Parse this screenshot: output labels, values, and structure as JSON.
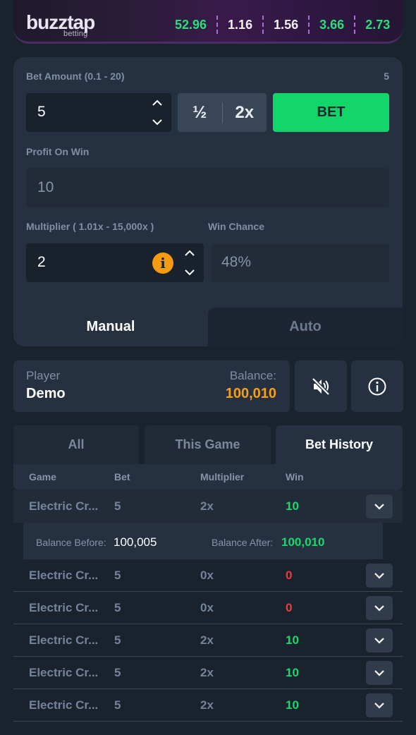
{
  "header": {
    "logo_main": "buzztap",
    "logo_sub": "betting",
    "multipliers": [
      {
        "value": "52.96",
        "color": "green"
      },
      {
        "value": "1.16",
        "color": "white"
      },
      {
        "value": "1.56",
        "color": "white"
      },
      {
        "value": "3.66",
        "color": "green"
      },
      {
        "value": "2.73",
        "color": "green"
      }
    ]
  },
  "bet_panel": {
    "bet_amount_label": "Bet Amount (0.1 - 20)",
    "bet_amount_right": "5",
    "bet_amount_value": "5",
    "half_label": "½",
    "double_label": "2x",
    "bet_button": "BET",
    "profit_label": "Profit On Win",
    "profit_value": "10",
    "multiplier_label": "Multiplier ( 1.01x - 15,000x )",
    "multiplier_value": "2",
    "win_chance_label": "Win Chance",
    "win_chance_value": "48%",
    "tabs": {
      "manual": "Manual",
      "auto": "Auto"
    }
  },
  "player": {
    "player_label": "Player",
    "player_name": "Demo",
    "balance_label": "Balance:",
    "balance_value": "100,010"
  },
  "history": {
    "tabs": {
      "all": "All",
      "this_game": "This Game",
      "bet_history": "Bet History"
    },
    "columns": {
      "game": "Game",
      "bet": "Bet",
      "multiplier": "Multiplier",
      "win": "Win"
    },
    "rows": [
      {
        "game": "Electric Cr...",
        "bet": "5",
        "multiplier": "2x",
        "win": "10",
        "win_color": "green"
      },
      {
        "game": "Electric Cr...",
        "bet": "5",
        "multiplier": "0x",
        "win": "0",
        "win_color": "red"
      },
      {
        "game": "Electric Cr...",
        "bet": "5",
        "multiplier": "0x",
        "win": "0",
        "win_color": "red"
      },
      {
        "game": "Electric Cr...",
        "bet": "5",
        "multiplier": "2x",
        "win": "10",
        "win_color": "green"
      },
      {
        "game": "Electric Cr...",
        "bet": "5",
        "multiplier": "2x",
        "win": "10",
        "win_color": "green"
      },
      {
        "game": "Electric Cr...",
        "bet": "5",
        "multiplier": "2x",
        "win": "10",
        "win_color": "green"
      }
    ],
    "detail": {
      "balance_before_label": "Balance Before:",
      "balance_before_value": "100,005",
      "balance_after_label": "Balance After:",
      "balance_after_value": "100,010"
    }
  },
  "colors": {
    "accent_green": "#12d66a",
    "accent_orange": "#f79e1b",
    "loss_red": "#ec3b3b"
  }
}
